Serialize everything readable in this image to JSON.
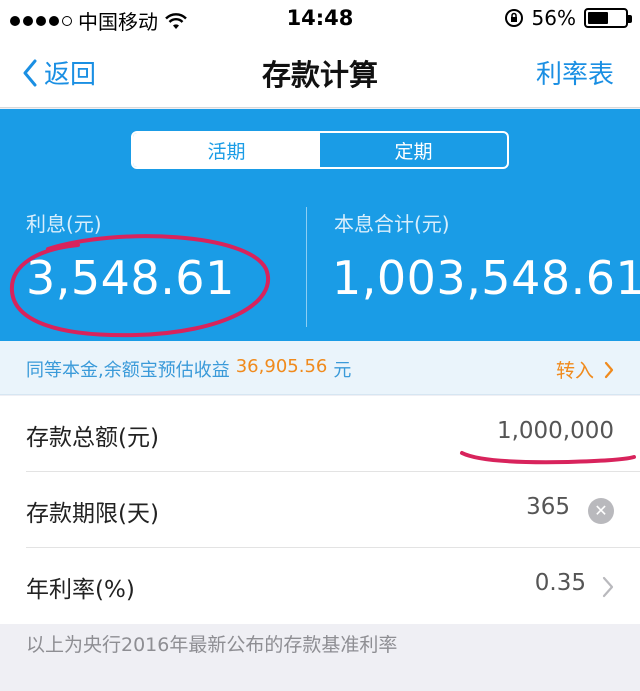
{
  "status_bar": {
    "carrier": "中国移动",
    "time": "14:48",
    "battery_percent": "56%",
    "battery_level": 0.56
  },
  "nav": {
    "back_label": "返回",
    "title": "存款计算",
    "right_label": "利率表"
  },
  "segments": [
    {
      "label": "活期",
      "active": true
    },
    {
      "label": "定期",
      "active": false
    }
  ],
  "summary": {
    "interest_label": "利息(元)",
    "interest_value": "3,548.61",
    "total_label": "本息合计(元)",
    "total_value": "1,003,548.61"
  },
  "promo": {
    "text": "同等本金,余额宝预估收益",
    "amount": "36,905.56",
    "unit": "元",
    "link_label": "转入"
  },
  "form": {
    "amount_label": "存款总额(元)",
    "amount_value": "1,000,000",
    "term_label": "存款期限(天)",
    "term_value": "365",
    "rate_label": "年利率(%)",
    "rate_value": "0.35"
  },
  "footer_note": "以上为央行2016年最新公布的存款基准利率",
  "colors": {
    "accent_blue": "#1a9ce6",
    "link_blue": "#1a8fe3",
    "orange": "#f08a1c",
    "annotation_red": "#d8235c"
  }
}
